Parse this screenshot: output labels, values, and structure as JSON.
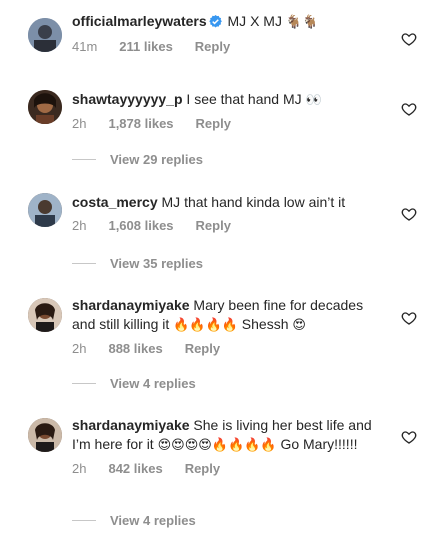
{
  "comments": [
    {
      "username": "officialmarleywaters",
      "verified": true,
      "text": "MJ X MJ",
      "emoji": "🐐🐐",
      "time": "41m",
      "likes": "211 likes",
      "reply": "Reply"
    },
    {
      "username": "shawtayyyyyy_p",
      "text": "I see that hand MJ",
      "emoji": "👀",
      "time": "2h",
      "likes": "1,878 likes",
      "reply": "Reply",
      "view_replies": "View 29 replies"
    },
    {
      "username": "costa_mercy",
      "text": "MJ that hand kinda low ain’t it",
      "time": "2h",
      "likes": "1,608 likes",
      "reply": "Reply",
      "view_replies": "View 35 replies"
    },
    {
      "username": "shardanaymiyake",
      "text": "Mary been fine for decades and still killing it",
      "emoji": "🔥🔥🔥🔥",
      "text2": "Shessh",
      "emoji2": "😍",
      "time": "2h",
      "likes": "888 likes",
      "reply": "Reply",
      "view_replies": "View 4 replies"
    },
    {
      "username": "shardanaymiyake",
      "text": "She is living her best life and I’m here for it",
      "emoji": "😍😍😍😍🔥🔥🔥🔥",
      "text2": "Go Mary!!!!!!",
      "time": "2h",
      "likes": "842 likes",
      "reply": "Reply",
      "view_replies": "View 4 replies"
    }
  ],
  "colors": {
    "text": "#262626",
    "secondary": "#8e8e8e",
    "verified": "#3897f0",
    "line": "#c7c7c7"
  },
  "icons": {
    "like": "heart-outline-icon",
    "verified": "verified-badge-icon"
  }
}
